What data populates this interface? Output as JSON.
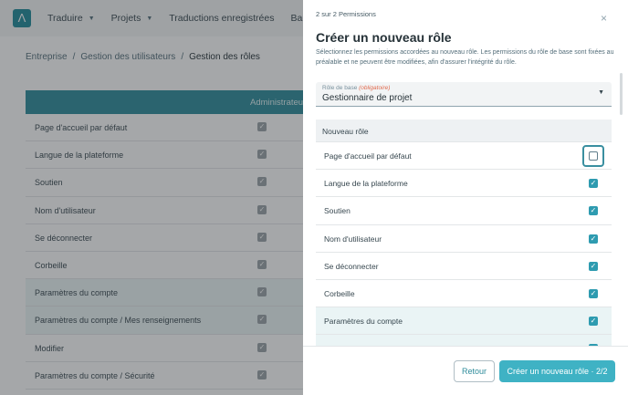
{
  "topbar": {
    "logo": "Λ",
    "nav": [
      {
        "label": "Traduire",
        "dropdown": true
      },
      {
        "label": "Projets",
        "dropdown": true
      },
      {
        "label": "Traductions enregistrées",
        "dropdown": false
      },
      {
        "label": "Banq",
        "dropdown": false
      }
    ]
  },
  "breadcrumb": {
    "items": [
      "Entreprise",
      "Gestion des utilisateurs"
    ],
    "current": "Gestion des rôles",
    "separator": "/"
  },
  "table": {
    "column_header": "Administrateur",
    "rows": [
      {
        "label": "Page d'accueil par défaut",
        "checked": true
      },
      {
        "label": "Langue de la plateforme",
        "checked": true
      },
      {
        "label": "Soutien",
        "checked": true
      },
      {
        "label": "Nom d'utilisateur",
        "checked": true
      },
      {
        "label": "Se déconnecter",
        "checked": true
      },
      {
        "label": "Corbeille",
        "checked": true
      },
      {
        "label": "Paramètres du compte",
        "checked": true,
        "shaded": true
      },
      {
        "label": "Paramètres du compte / Mes renseignements",
        "checked": true,
        "shaded": true
      },
      {
        "label": "Modifier",
        "checked": true
      },
      {
        "label": "Paramètres du compte / Sécurité",
        "checked": true
      }
    ]
  },
  "modal": {
    "step": "2 sur 2 Permissions",
    "close_icon": "×",
    "title": "Créer un nouveau rôle",
    "subtitle": "Sélectionnez les permissions accordées au nouveau rôle. Les permissions du rôle de base sont fixées au préalable et ne peuvent être modifiées, afin d'assurer l'intégrité du rôle.",
    "base_role": {
      "label": "Rôle de base",
      "required": "(obligatoire)",
      "value": "Gestionnaire de projet"
    },
    "list_header": "Nouveau rôle",
    "permissions": [
      {
        "label": "Page d'accueil par défaut",
        "checked": false,
        "focused": true
      },
      {
        "label": "Langue de la plateforme",
        "checked": true
      },
      {
        "label": "Soutien",
        "checked": true
      },
      {
        "label": "Nom d'utilisateur",
        "checked": true
      },
      {
        "label": "Se déconnecter",
        "checked": true
      },
      {
        "label": "Corbeille",
        "checked": true
      },
      {
        "label": "Paramètres du compte",
        "checked": true,
        "shaded": true
      },
      {
        "label": "",
        "checked": true,
        "shaded": true
      }
    ],
    "buttons": {
      "back": "Retour",
      "create": "Créer un nouveau rôle · 2/2"
    },
    "colors": {
      "accent": "#3fb2c4",
      "header": "#2e8c9b"
    }
  }
}
